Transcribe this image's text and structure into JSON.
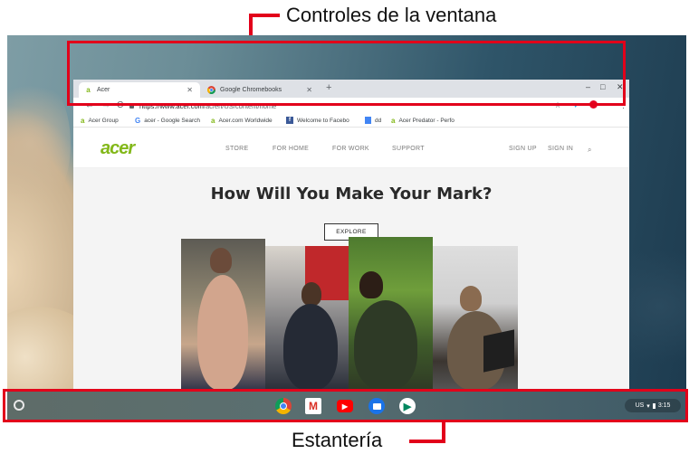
{
  "callouts": {
    "top": "Controles de la ventana",
    "bottom": "Estantería"
  },
  "colors": {
    "highlight": "#e2001a",
    "acer_green": "#83b81a",
    "tabstrip": "#dee1e6"
  },
  "browser": {
    "tabs": [
      {
        "label": "Acer",
        "icon": "acer-logo-icon",
        "active": true
      },
      {
        "label": "Google Chromebooks",
        "icon": "chrome-icon",
        "active": false
      }
    ],
    "new_tab": "+",
    "url_host": "https://www.acer.com",
    "url_path": "/ac/en/US/content/home",
    "bookmarks": [
      {
        "label": "Acer Group",
        "icon": "acer-logo-icon"
      },
      {
        "label": "acer - Google Search",
        "icon": "google-icon"
      },
      {
        "label": "Acer.com Worldwide",
        "icon": "acer-logo-icon"
      },
      {
        "label": "Welcome to Facebo",
        "icon": "facebook-icon"
      },
      {
        "label": "dd",
        "icon": "docs-icon"
      },
      {
        "label": "Acer Predator - Perfo",
        "icon": "acer-logo-icon"
      }
    ]
  },
  "site": {
    "logo": "acer",
    "nav": [
      "STORE",
      "FOR HOME",
      "FOR WORK",
      "SUPPORT"
    ],
    "sign_up": "SIGN UP",
    "sign_in": "SIGN IN",
    "headline": "How Will You Make Your Mark?",
    "cta": "EXPLORE"
  },
  "shelf": {
    "apps": [
      "chrome-icon",
      "gmail-icon",
      "youtube-icon",
      "files-icon",
      "play-store-icon"
    ],
    "locale": "US",
    "time": "3:15"
  }
}
